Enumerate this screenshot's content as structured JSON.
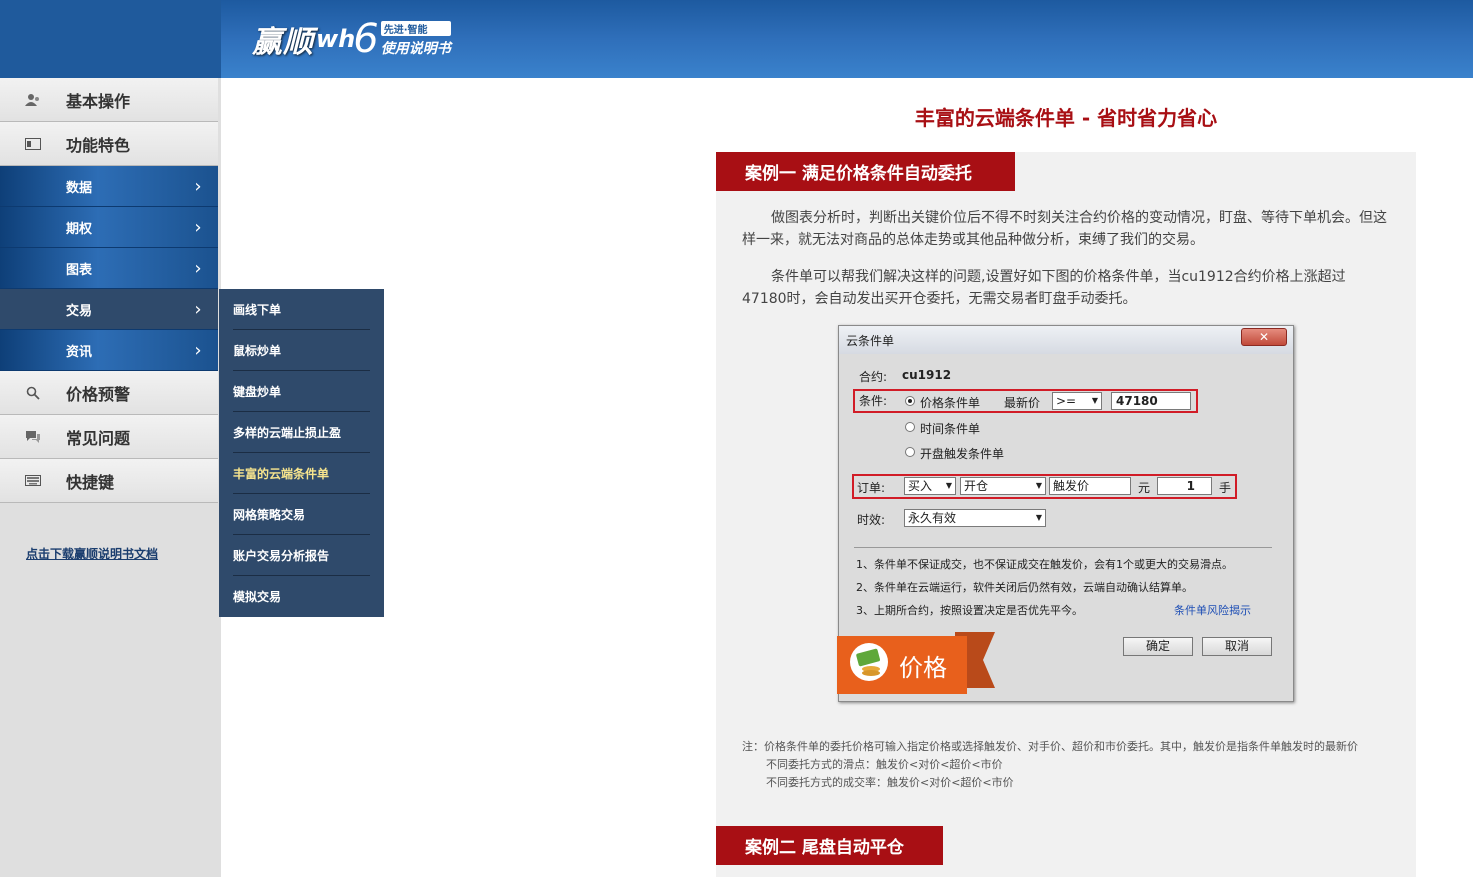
{
  "header": {
    "logo_cn": "赢顺",
    "logo_wh": "wh",
    "logo_six": "6",
    "logo_tag1": "先进·智能",
    "logo_tag2": "使用说明书"
  },
  "sidebar": {
    "main_items": [
      {
        "label": "基本操作",
        "icon": "user-icon"
      },
      {
        "label": "功能特色",
        "icon": "card-icon"
      }
    ],
    "sub_items": [
      {
        "label": "数据"
      },
      {
        "label": "期权"
      },
      {
        "label": "图表"
      },
      {
        "label": "交易"
      },
      {
        "label": "资讯"
      }
    ],
    "main_items_2": [
      {
        "label": "价格预警",
        "icon": "search-icon"
      },
      {
        "label": "常见问题",
        "icon": "chat-icon"
      },
      {
        "label": "快捷键",
        "icon": "keyboard-icon"
      }
    ],
    "download_link": "点击下载赢顺说明书文档"
  },
  "flyout": {
    "items": [
      "画线下单",
      "鼠标炒单",
      "键盘炒单",
      "多样的云端止损止盈",
      "丰富的云端条件单",
      "网格策略交易",
      "账户交易分析报告",
      "模拟交易"
    ]
  },
  "main": {
    "title": "丰富的云端条件单 - 省时省力省心",
    "case1_title": "案例一 满足价格条件自动委托",
    "para1": "做图表分析时，判断出关键价位后不得不时刻关注合约价格的变动情况，盯盘、等待下单机会。但这样一来，就无法对商品的总体走势或其他品种做分析，束缚了我们的交易。",
    "para2": "条件单可以帮我们解决这样的问题,设置好如下图的价格条件单，当cu1912合约价格上涨超过47180时，会自动发出买开仓委托，无需交易者盯盘手动委托。",
    "case2_title": "案例二 尾盘自动平仓",
    "note_line1": "注：价格条件单的委托价格可输入指定价格或选择触发价、对手价、超价和市价委托。其中，触发价是指条件单触发时的最新价",
    "note_line2": "不同委托方式的滑点：触发价<对价<超价<市价",
    "note_line3": "不同委托方式的成交率：触发价<对价<超价<市价"
  },
  "dialog": {
    "title": "云条件单",
    "contract_label": "合约:",
    "contract_value": "cu1912",
    "condition_label": "条件:",
    "radio_price": "价格条件单",
    "latest_price_label": "最新价",
    "operator": ">=",
    "price_value": "47180",
    "radio_time": "时间条件单",
    "radio_open": "开盘触发条件单",
    "order_label": "订单:",
    "direction": "买入",
    "offset": "开仓",
    "price_type": "触发价",
    "currency": "元",
    "quantity": "1",
    "unit": "手",
    "validity_label": "时效:",
    "validity": "永久有效",
    "rule1": "1、条件单不保证成交，也不保证成交在触发价，会有1个或更大的交易滑点。",
    "rule2": "2、条件单在云端运行，软件关闭后仍然有效，云端自动确认结算单。",
    "rule3": "3、上期所合约，按照设置决定是否优先平今。",
    "risk_link": "条件单风险揭示",
    "ok": "确定",
    "cancel": "取消",
    "badge": "价格"
  }
}
